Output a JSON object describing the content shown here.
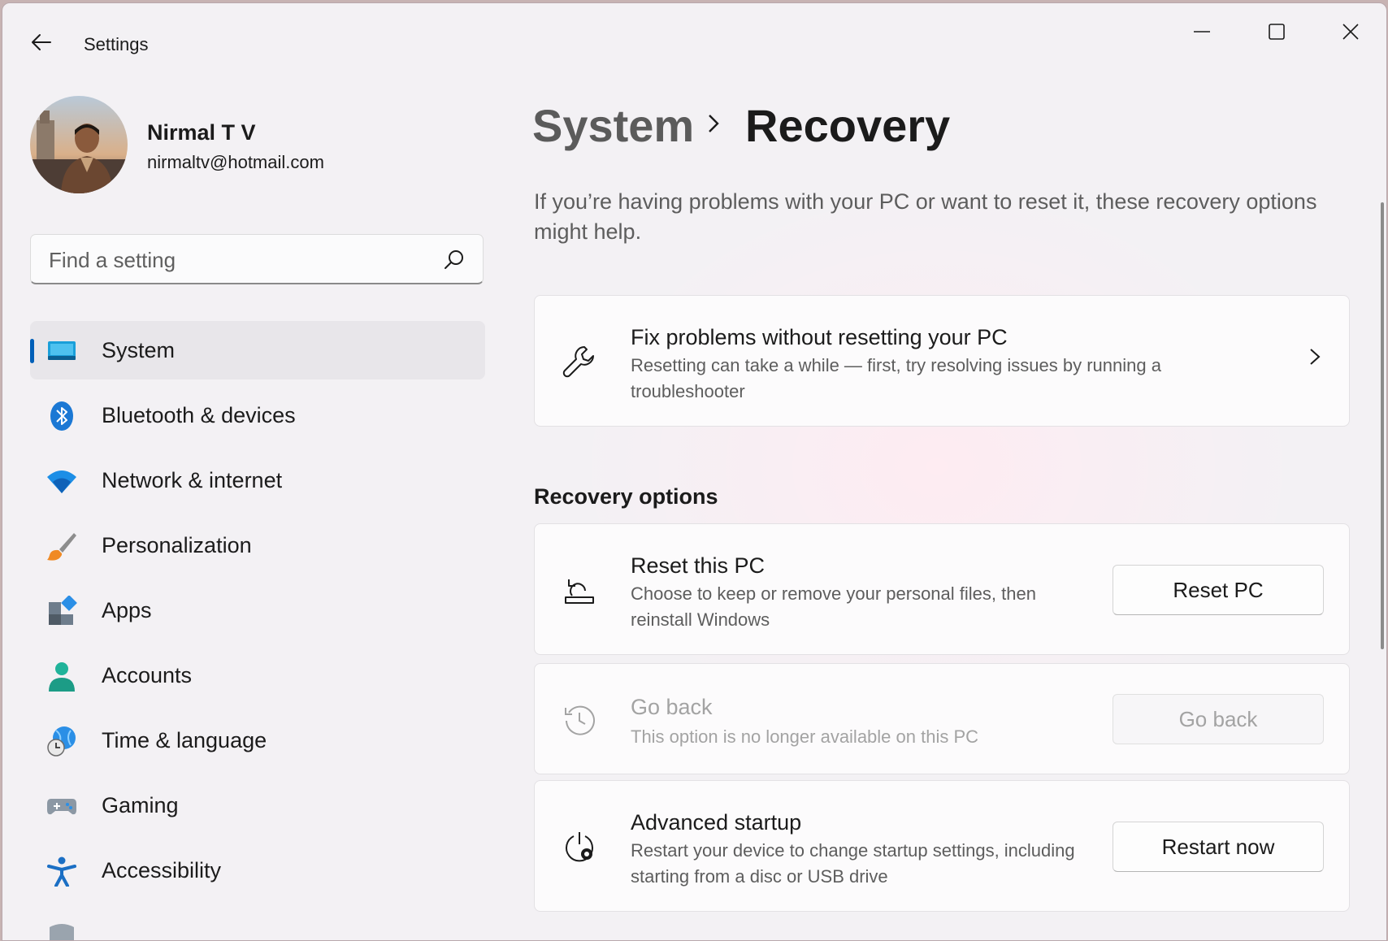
{
  "window": {
    "title": "Settings",
    "controls": [
      "minimize",
      "maximize",
      "close"
    ]
  },
  "profile": {
    "name": "Nirmal T V",
    "email": "nirmaltv@hotmail.com"
  },
  "search": {
    "placeholder": "Find a setting",
    "value": ""
  },
  "sidebar": {
    "items": [
      {
        "label": "System",
        "icon": "system-monitor-icon",
        "active": true
      },
      {
        "label": "Bluetooth & devices",
        "icon": "bluetooth-icon"
      },
      {
        "label": "Network & internet",
        "icon": "wifi-icon"
      },
      {
        "label": "Personalization",
        "icon": "paintbrush-icon"
      },
      {
        "label": "Apps",
        "icon": "apps-icon"
      },
      {
        "label": "Accounts",
        "icon": "person-icon"
      },
      {
        "label": "Time & language",
        "icon": "globe-clock-icon"
      },
      {
        "label": "Gaming",
        "icon": "gamepad-icon"
      },
      {
        "label": "Accessibility",
        "icon": "accessibility-icon"
      }
    ]
  },
  "breadcrumb": {
    "parent": "System",
    "current": "Recovery"
  },
  "intro": "If you’re having problems with your PC or want to reset it, these recovery options might help.",
  "fix_card": {
    "title": "Fix problems without resetting your PC",
    "description": "Resetting can take a while — first, try resolving issues by running a troubleshooter",
    "icon": "wrench-icon"
  },
  "recovery_options": {
    "heading": "Recovery options",
    "items": [
      {
        "title": "Reset this PC",
        "description": "Choose to keep or remove your personal files, then reinstall Windows",
        "button": "Reset PC",
        "icon": "reset-pc-icon",
        "enabled": true
      },
      {
        "title": "Go back",
        "description": "This option is no longer available on this PC",
        "button": "Go back",
        "icon": "history-icon",
        "enabled": false
      },
      {
        "title": "Advanced startup",
        "description": "Restart your device to change startup settings, including starting from a disc or USB drive",
        "button": "Restart now",
        "icon": "advanced-startup-icon",
        "enabled": true
      }
    ]
  },
  "colors": {
    "accent": "#005fb8",
    "window_bg": "#f3f1f4",
    "card_bg": "#fcfbfc",
    "disabled_text": "#a3a3a3"
  }
}
